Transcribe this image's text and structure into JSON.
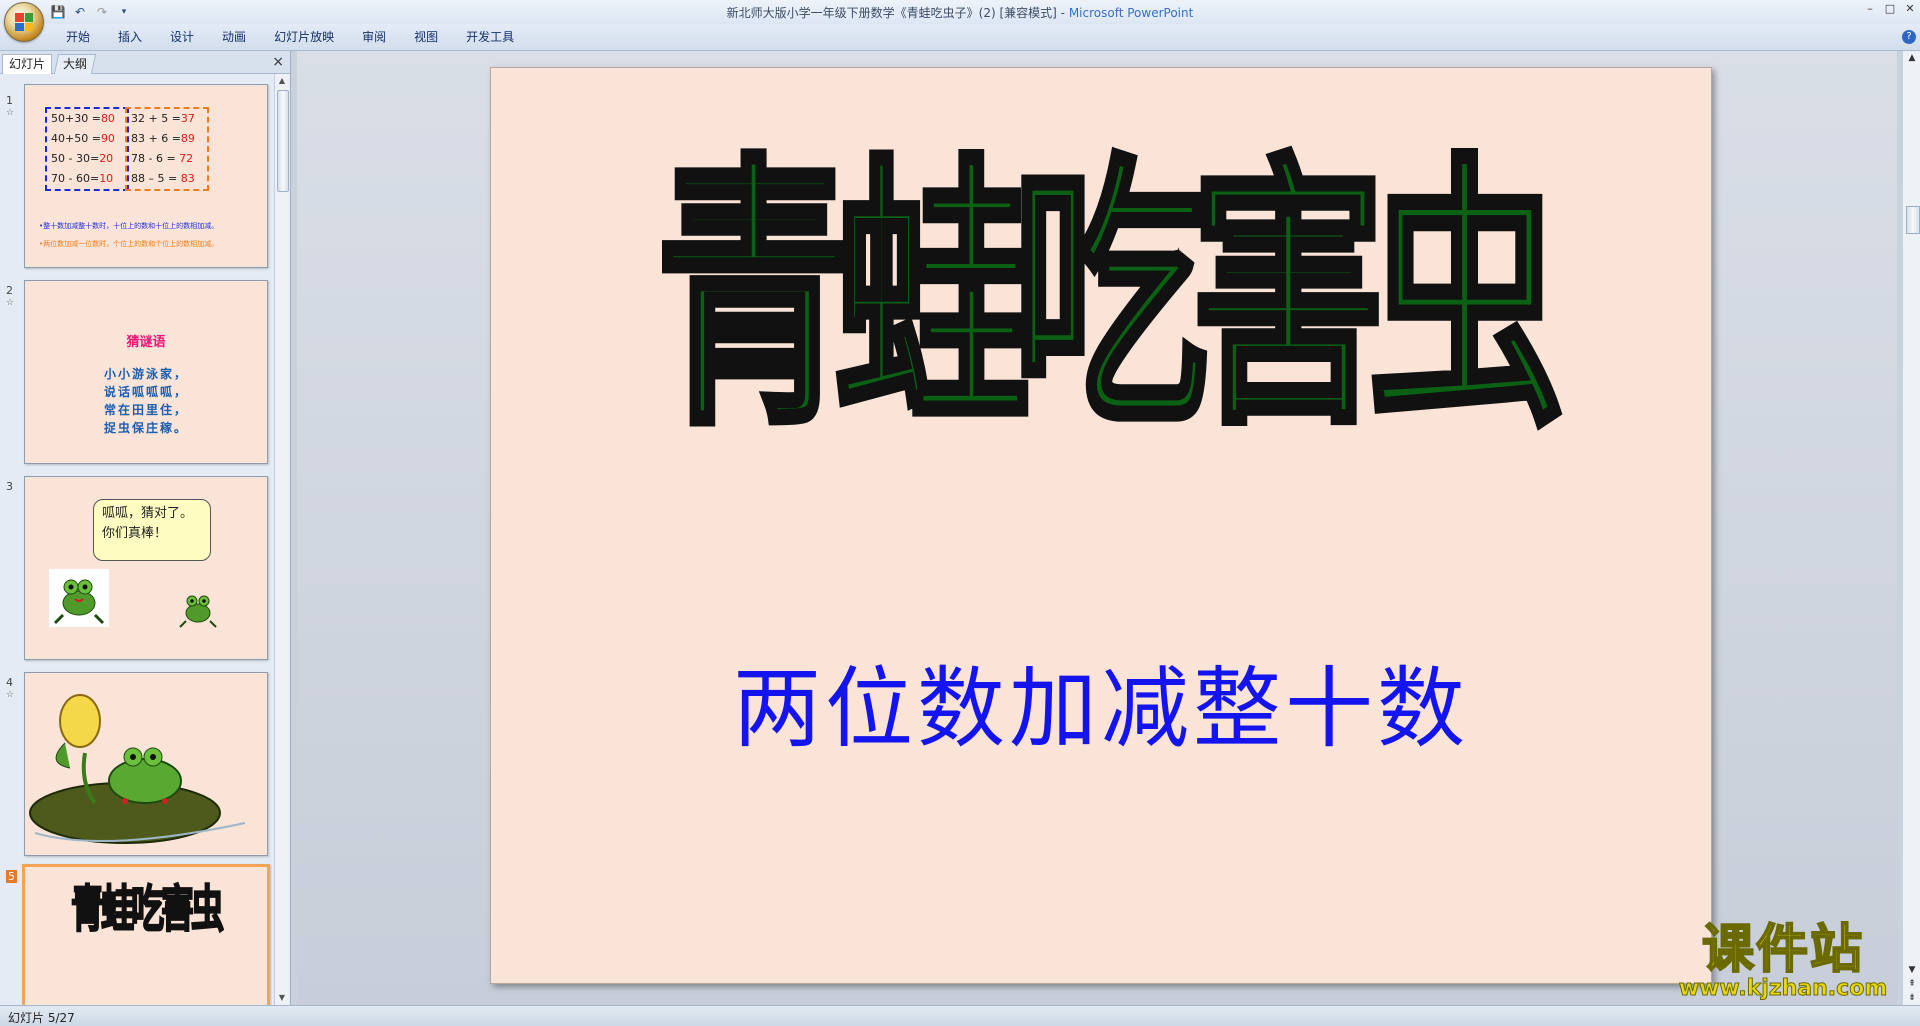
{
  "window": {
    "title_doc": "新北师大版小学一年级下册数学《青蛙吃虫子》(2) [兼容模式] - ",
    "title_app": "Microsoft PowerPoint",
    "controls": [
      "–",
      "□",
      "✕"
    ]
  },
  "ribbon": {
    "tabs": [
      "开始",
      "插入",
      "设计",
      "动画",
      "幻灯片放映",
      "审阅",
      "视图",
      "开发工具"
    ],
    "help": "?"
  },
  "panel": {
    "tab_slides": "幻灯片",
    "tab_outline": "大纲",
    "close": "×"
  },
  "thumbnails": {
    "slide1": {
      "num": "1",
      "left_rows": [
        {
          "expr": "50+30 =",
          "ans": "80"
        },
        {
          "expr": "40+50 =",
          "ans": "90"
        },
        {
          "expr": "50 - 30=",
          "ans": "20"
        },
        {
          "expr": "70 - 60=",
          "ans": "10"
        }
      ],
      "right_rows": [
        {
          "expr": "32 + 5 =",
          "ans": "37"
        },
        {
          "expr": "83 + 6 =",
          "ans": "89"
        },
        {
          "expr": "78 - 6 = ",
          "ans": "72"
        },
        {
          "expr": "88 – 5 = ",
          "ans": "83"
        }
      ],
      "note1": "•整十数加减整十数时，十位上的数和十位上的数相加减。",
      "note2": "•两位数加减一位数时，个位上的数和个位上的数相加减。"
    },
    "slide2": {
      "num": "2",
      "title": "猜谜语",
      "lines": [
        "小小游泳家，",
        "说话呱呱呱，",
        "常在田里住，",
        "捉虫保庄稼。"
      ]
    },
    "slide3": {
      "num": "3",
      "bubble_line1": "呱呱，猜对了。",
      "bubble_line2": "你们真棒！"
    },
    "slide4": {
      "num": "4"
    },
    "slide5": {
      "num": "5",
      "title": "青蛙吃害虫"
    }
  },
  "slide": {
    "title": "青蛙吃害虫",
    "subtitle": "两位数加减整十数"
  },
  "status": {
    "slide_indicator": "幻灯片 5/27"
  },
  "watermark": {
    "cn": "课件站",
    "url": "www.kjzhan.com"
  },
  "colors": {
    "title_green": "#0a6114",
    "subtitle_blue": "#1414ee",
    "slide_bg": "#fae3d7",
    "selected_thumb_border": "#f5a455"
  }
}
